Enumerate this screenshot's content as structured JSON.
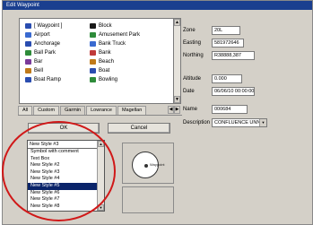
{
  "window": {
    "title": "Edit Waypoint"
  },
  "waypoint_icons": {
    "left": [
      {
        "label": "[ Waypoint ]",
        "color": "#2a4db0"
      },
      {
        "label": "Airport",
        "color": "#3a6ad0"
      },
      {
        "label": "Anchorage",
        "color": "#2a4db0"
      },
      {
        "label": "Ball Park",
        "color": "#2e8b3a"
      },
      {
        "label": "Bar",
        "color": "#7a3a9a"
      },
      {
        "label": "Bell",
        "color": "#c07a1a"
      },
      {
        "label": "Boat Ramp",
        "color": "#2a4db0"
      }
    ],
    "right": [
      {
        "label": "Block",
        "color": "#1a1a1a"
      },
      {
        "label": "Amusement Park",
        "color": "#2e8b3a"
      },
      {
        "label": "Bank Truck",
        "color": "#3a6ad0"
      },
      {
        "label": "Bank",
        "color": "#c03a3a"
      },
      {
        "label": "Beach",
        "color": "#c07a1a"
      },
      {
        "label": "Boat",
        "color": "#2a4db0"
      },
      {
        "label": "Bowling",
        "color": "#2e8b3a"
      }
    ]
  },
  "tabs": [
    "All",
    "Custom",
    "Garmin",
    "Lowrance",
    "Magellan"
  ],
  "buttons": {
    "ok": "OK",
    "cancel": "Cancel"
  },
  "style_list": {
    "selected_value": "New Style #3",
    "items": [
      "Symbol with comment",
      "Text Box",
      "New Style #2",
      "New Style #3",
      "New Style #4",
      "New Style #5",
      "New Style #6",
      "New Style #7",
      "New Style #8"
    ],
    "selected_index": 5
  },
  "preview": {
    "label": "Waypoint"
  },
  "properties": [
    {
      "label": "Zone",
      "value": "20L"
    },
    {
      "label": "Easting",
      "value": "581972646"
    },
    {
      "label": "Northing",
      "value": "R38888,387"
    },
    {
      "label": "Altitude",
      "value": "0.000"
    },
    {
      "label": "Date",
      "value": "06/06/10 00:00:00"
    },
    {
      "label": "Name",
      "value": "000684"
    },
    {
      "label": "Description",
      "value": "CONFLUENCE UNNAMED CREEK 11"
    }
  ]
}
